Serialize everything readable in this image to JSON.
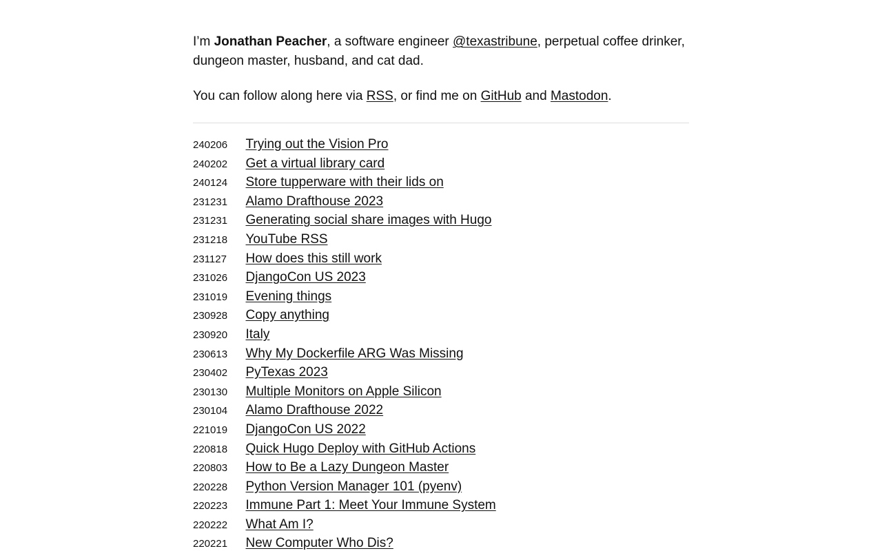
{
  "intro": {
    "prefix": "I’m ",
    "name": "Jonathan Peacher",
    "role_text": ", a software engineer ",
    "employer_link": "@texastribune",
    "suffix": ", perpetual coffee drinker, dungeon master, husband, and cat dad."
  },
  "follow": {
    "prefix": "You can follow along here via ",
    "rss_link": "RSS",
    "middle": ", or find me on ",
    "github_link": "GitHub",
    "and_text": " and ",
    "mastodon_link": "Mastodon",
    "end": "."
  },
  "posts": [
    {
      "date": "240206",
      "title": "Trying out the Vision Pro"
    },
    {
      "date": "240202",
      "title": "Get a virtual library card"
    },
    {
      "date": "240124",
      "title": "Store tupperware with their lids on"
    },
    {
      "date": "231231",
      "title": "Alamo Drafthouse 2023"
    },
    {
      "date": "231231",
      "title": "Generating social share images with Hugo"
    },
    {
      "date": "231218",
      "title": "YouTube RSS"
    },
    {
      "date": "231127",
      "title": "How does this still work"
    },
    {
      "date": "231026",
      "title": "DjangoCon US 2023"
    },
    {
      "date": "231019",
      "title": "Evening things"
    },
    {
      "date": "230928",
      "title": "Copy anything"
    },
    {
      "date": "230920",
      "title": "Italy"
    },
    {
      "date": "230613",
      "title": "Why My Dockerfile ARG Was Missing"
    },
    {
      "date": "230402",
      "title": "PyTexas 2023"
    },
    {
      "date": "230130",
      "title": "Multiple Monitors on Apple Silicon"
    },
    {
      "date": "230104",
      "title": "Alamo Drafthouse 2022"
    },
    {
      "date": "221019",
      "title": "DjangoCon US 2022"
    },
    {
      "date": "220818",
      "title": "Quick Hugo Deploy with GitHub Actions"
    },
    {
      "date": "220803",
      "title": "How to Be a Lazy Dungeon Master"
    },
    {
      "date": "220228",
      "title": "Python Version Manager 101 (pyenv)"
    },
    {
      "date": "220223",
      "title": "Immune Part 1: Meet Your Immune System"
    },
    {
      "date": "220222",
      "title": "What Am I?"
    },
    {
      "date": "220221",
      "title": "New Computer Who Dis?"
    }
  ]
}
